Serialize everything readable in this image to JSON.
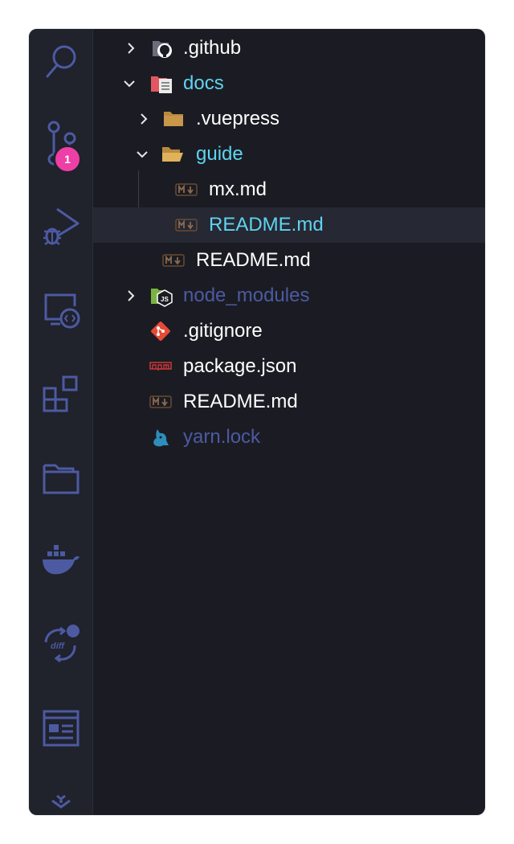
{
  "activity_bar": {
    "items": [
      "search-icon",
      "source-control-icon",
      "run-debug-icon",
      "remote-explorer-icon",
      "extensions-icon",
      "explorer-folder-icon",
      "docker-icon",
      "diff-icon",
      "browser-preview-icon",
      "more-icon"
    ],
    "source_control_badge": "1",
    "icon_color": "#4c5aa1",
    "badge_color": "#ee3fa6"
  },
  "explorer": {
    "items": [
      {
        "label": ".github",
        "kind": "folder",
        "expanded": false,
        "depth": 0,
        "icon": "github-folder-icon"
      },
      {
        "label": "docs",
        "kind": "folder",
        "expanded": true,
        "depth": 0,
        "icon": "docs-folder-icon"
      },
      {
        "label": ".vuepress",
        "kind": "folder",
        "expanded": false,
        "depth": 1,
        "icon": "folder-icon"
      },
      {
        "label": "guide",
        "kind": "folder",
        "expanded": true,
        "depth": 1,
        "icon": "folder-open-icon"
      },
      {
        "label": "mx.md",
        "kind": "file",
        "depth": 2,
        "icon": "markdown-icon"
      },
      {
        "label": "README.md",
        "kind": "file",
        "depth": 2,
        "icon": "markdown-icon",
        "selected": true
      },
      {
        "label": "README.md",
        "kind": "file",
        "depth": 1,
        "icon": "markdown-icon"
      },
      {
        "label": "node_modules",
        "kind": "folder",
        "expanded": false,
        "depth": 0,
        "icon": "node-folder-icon",
        "ignored": true
      },
      {
        "label": ".gitignore",
        "kind": "file",
        "depth": 0,
        "icon": "git-icon"
      },
      {
        "label": "package.json",
        "kind": "file",
        "depth": 0,
        "icon": "npm-icon"
      },
      {
        "label": "README.md",
        "kind": "file",
        "depth": 0,
        "icon": "markdown-icon"
      },
      {
        "label": "yarn.lock",
        "kind": "file",
        "depth": 0,
        "icon": "yarn-icon",
        "ignored": true
      }
    ]
  },
  "colors": {
    "background": "#1b1c23",
    "activity_bar": "#20222c",
    "selection": "#262833",
    "text": "#ffffff",
    "active_text": "#5fd4f1",
    "ignored_text": "#4c5aa1"
  }
}
